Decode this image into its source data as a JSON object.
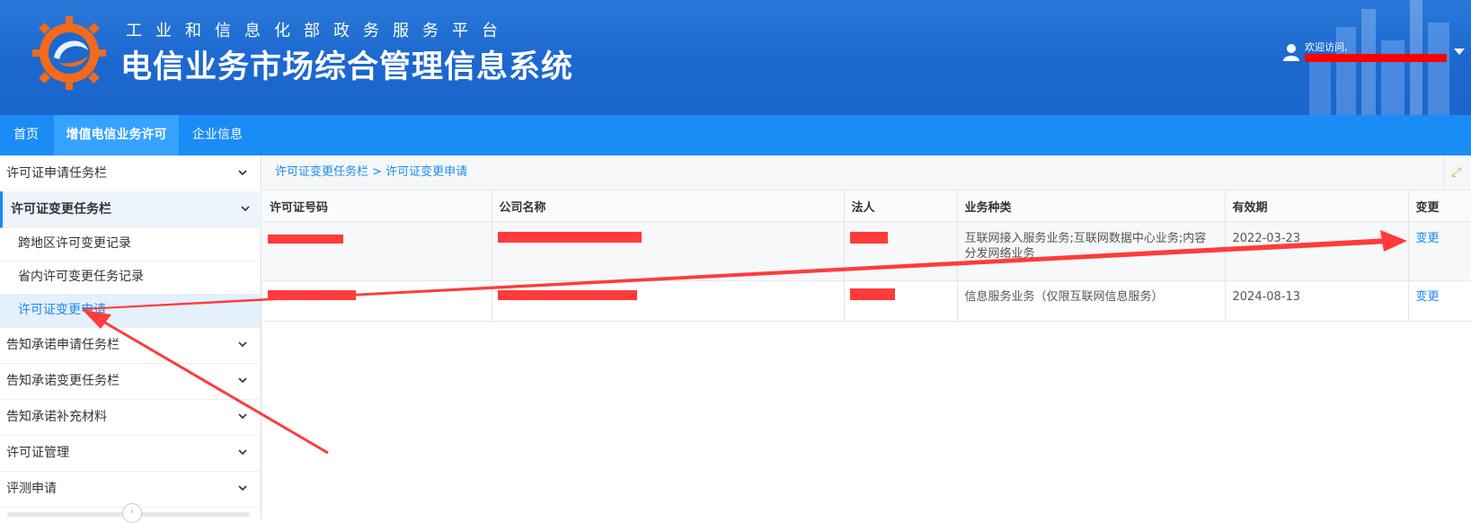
{
  "header": {
    "platform_title": "工业和信息化部政务服务平台",
    "system_title": "电信业务市场综合管理信息系统",
    "welcome": "欢迎访问,"
  },
  "nav": {
    "items": [
      {
        "label": "首页"
      },
      {
        "label": "增值电信业务许可"
      },
      {
        "label": "企业信息"
      }
    ]
  },
  "sidebar": {
    "groups": [
      {
        "label": "许可证申请任务栏"
      },
      {
        "label": "许可证变更任务栏"
      },
      {
        "label": "告知承诺申请任务栏"
      },
      {
        "label": "告知承诺变更任务栏"
      },
      {
        "label": "告知承诺补充材料"
      },
      {
        "label": "许可证管理"
      },
      {
        "label": "评测申请"
      }
    ],
    "sub_items": [
      {
        "label": "跨地区许可变更记录"
      },
      {
        "label": "省内许可变更任务记录"
      },
      {
        "label": "许可证变更申请"
      }
    ]
  },
  "breadcrumb": "许可证变更任务栏 > 许可证变更申请",
  "table": {
    "headers": [
      "许可证号码",
      "公司名称",
      "法人",
      "业务种类",
      "有效期",
      "变更"
    ],
    "rows": [
      {
        "business": "互联网接入服务业务;互联网数据中心业务;内容分发网络业务",
        "validity": "2022-03-23",
        "action": "变更"
      },
      {
        "business": "信息服务业务（仅限互联网信息服务）",
        "validity": "2024-08-13",
        "action": "变更"
      }
    ]
  },
  "colors": {
    "header_blue": "#1c68cf",
    "nav_blue": "#1a8cf5",
    "annotation_red": "#ff3b3b"
  }
}
